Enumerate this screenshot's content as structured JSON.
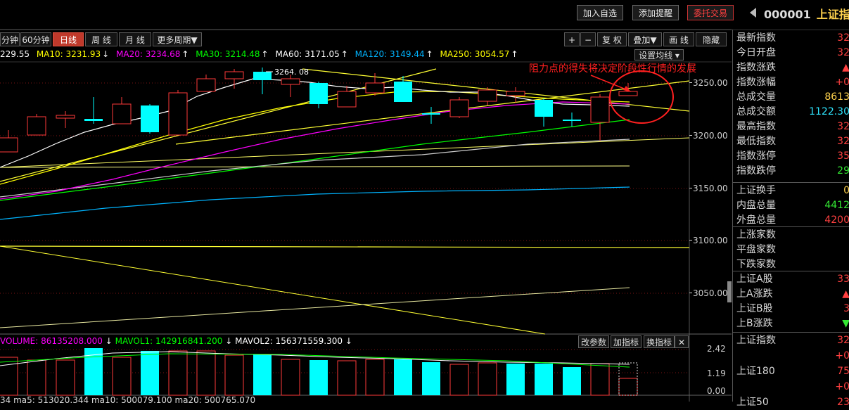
{
  "toolbar": {
    "add_watch": "加入自选",
    "add_alert": "添加提醒",
    "order": "委托交易",
    "code": "000001",
    "name": "上证指"
  },
  "periods": [
    "分钟",
    "60分钟",
    "日线",
    "周 线",
    "月 线",
    "更多周期▼"
  ],
  "active_period": "日线",
  "tools": {
    "plus": "+",
    "minus": "−",
    "restore": "复 权",
    "overlay": "叠加▼",
    "draw": "画 线",
    "hide": "隐藏"
  },
  "ma_legend": {
    "ma5": "229.55",
    "ma10": "MA10: 3231.93",
    "ma20": "MA20: 3234.68",
    "ma30": "MA30: 3214.48",
    "ma60": "MA60: 3171.05",
    "ma120": "MA120: 3149.44",
    "ma250": "MA250: 3054.57",
    "set_ma": "设置均线 ▾"
  },
  "annotation": "阻力点的得失将决定阶段性行情的发展",
  "peak_label": "3264. 08",
  "price_axis": [
    "3250.00",
    "3200.00",
    "3150.00",
    "3100.00",
    "3050.00"
  ],
  "volume_legend": {
    "volume": "VOLUME: 86135208.000",
    "mavol1": "MAVOL1: 142916841.200",
    "mavol2": "MAVOL2: 156371559.300",
    "btn_params": "改参数",
    "btn_add": "加指标",
    "btn_switch": "换指标"
  },
  "volume_axis": [
    "2.42",
    "1.19",
    "0.00"
  ],
  "second_indicator": "34  ma5: 513020.344  ma10: 500079.100  ma20: 500765.070",
  "quote": {
    "group1": [
      {
        "label": "最新指数",
        "value": "32",
        "color": "#ff4040"
      },
      {
        "label": "今日开盘",
        "value": "32",
        "color": "#ff4040"
      },
      {
        "label": "指数涨跌",
        "value": "▲",
        "color": "#ff4040"
      },
      {
        "label": "指数涨幅",
        "value": "+0",
        "color": "#ff4040"
      },
      {
        "label": "总成交量",
        "value": "8613",
        "color": "#ffd24d"
      },
      {
        "label": "总成交额",
        "value": "1122.30",
        "color": "#2ee6ff"
      },
      {
        "label": "最高指数",
        "value": "32",
        "color": "#ff4040"
      },
      {
        "label": "最低指数",
        "value": "32",
        "color": "#ff4040"
      },
      {
        "label": "指数涨停",
        "value": "35",
        "color": "#ff4040"
      },
      {
        "label": "指数跌停",
        "value": "29",
        "color": "#33e633"
      }
    ],
    "group2": [
      {
        "label": "上证换手",
        "value": "0",
        "color": "#ffd24d"
      },
      {
        "label": "内盘总量",
        "value": "4412",
        "color": "#33e633"
      },
      {
        "label": "外盘总量",
        "value": "4200",
        "color": "#ff4040"
      }
    ],
    "group3": [
      {
        "label": "上涨家数",
        "value": "",
        "color": "#ff4040"
      },
      {
        "label": "平盘家数",
        "value": "",
        "color": "#ddd"
      },
      {
        "label": "下跌家数",
        "value": "",
        "color": "#33e633"
      }
    ],
    "group4": [
      {
        "label": "上证A股",
        "value": "33",
        "color": "#ff4040"
      },
      {
        "label": "上A涨跌",
        "value": "▲",
        "color": "#ff4040"
      },
      {
        "label": "上证B股",
        "value": "3",
        "color": "#ff4040"
      },
      {
        "label": "上B涨跌",
        "value": "▼",
        "color": "#33e633"
      }
    ],
    "group5": [
      {
        "label": "上证指数",
        "value": "32",
        "color": "#ff4040"
      },
      {
        "label": "",
        "value": "+0",
        "color": "#ff4040"
      },
      {
        "label": "上证180",
        "value": "75",
        "color": "#ff4040"
      },
      {
        "label": "",
        "value": "+0",
        "color": "#ff4040"
      },
      {
        "label": "上证50",
        "value": "23",
        "color": "#ff4040"
      }
    ]
  },
  "colors": {
    "up": "#ff3a3a",
    "down": "#00ffff",
    "ma5": "#ffffff",
    "ma10": "#ffff00",
    "ma20": "#ff00ff",
    "ma30": "#00ff00",
    "ma60": "#ffffff",
    "ma120": "#00b4ff",
    "ma250": "#ffff00"
  }
}
